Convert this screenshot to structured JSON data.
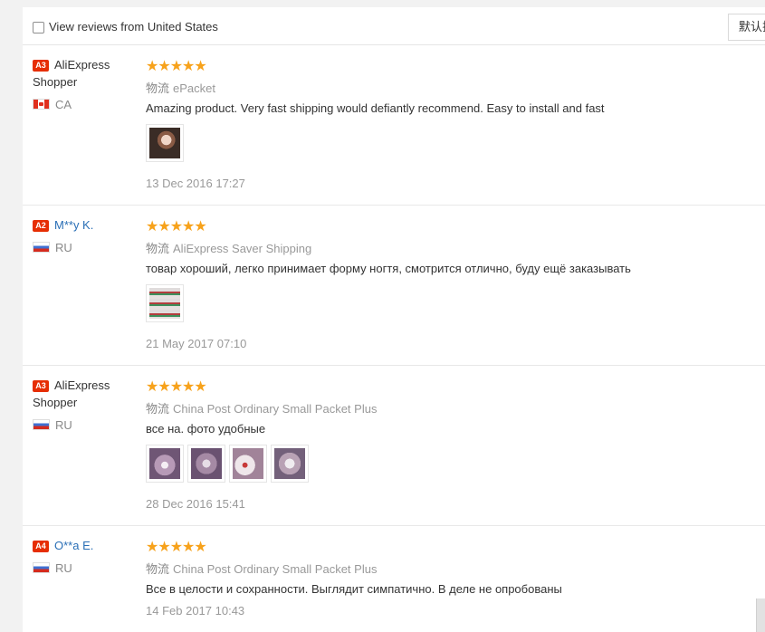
{
  "filter": {
    "label": "View reviews from United States",
    "checked": false
  },
  "sort": {
    "selected": "默认排序"
  },
  "reviews": [
    {
      "level": "A3",
      "name_line1": "AliExpress",
      "name_line2": "Shopper",
      "country": "CA",
      "flag": "ca",
      "stars": "★★★★★",
      "rating": 5,
      "shipping_label": "物流",
      "shipping": "ePacket",
      "text": "Amazing product. Very fast shipping would defiantly recommend. Easy to install and fast",
      "photos": [
        "photo-hand-nails"
      ],
      "date": "13 Dec 2016 17:27"
    },
    {
      "level": "A2",
      "name_line1": "M**y K.",
      "name_line2": "",
      "country": "RU",
      "flag": "ru",
      "stars": "★★★★★",
      "rating": 5,
      "shipping_label": "物流",
      "shipping": "AliExpress Saver Shipping",
      "text": "товар хороший, легко принимает форму ногтя, смотрится отлично, буду ещё заказывать",
      "photos": [
        "photo-sticker-sheet"
      ],
      "date": "21 May 2017 07:10"
    },
    {
      "level": "A3",
      "name_line1": "AliExpress",
      "name_line2": "Shopper",
      "country": "RU",
      "flag": "ru",
      "stars": "★★★★★",
      "rating": 5,
      "shipping_label": "物流",
      "shipping": "China Post Ordinary Small Packet Plus",
      "text": "все на. фото удобные",
      "photos": [
        "photo-nail-1",
        "photo-nail-2",
        "photo-nail-3",
        "photo-nail-4"
      ],
      "date": "28 Dec 2016 15:41"
    },
    {
      "level": "A4",
      "name_line1": "O**a E.",
      "name_line2": "",
      "country": "RU",
      "flag": "ru",
      "stars": "★★★★★",
      "rating": 5,
      "shipping_label": "物流",
      "shipping": "China Post Ordinary Small Packet Plus",
      "text": "Все в целости и сохранности. Выглядит симпатично. В деле не опробованы",
      "photos": [],
      "date": "14 Feb 2017 10:43"
    }
  ],
  "colors": {
    "level_badge": "#e62e04",
    "star": "#f7a21b",
    "buyer_link": "#2a6fb6"
  }
}
